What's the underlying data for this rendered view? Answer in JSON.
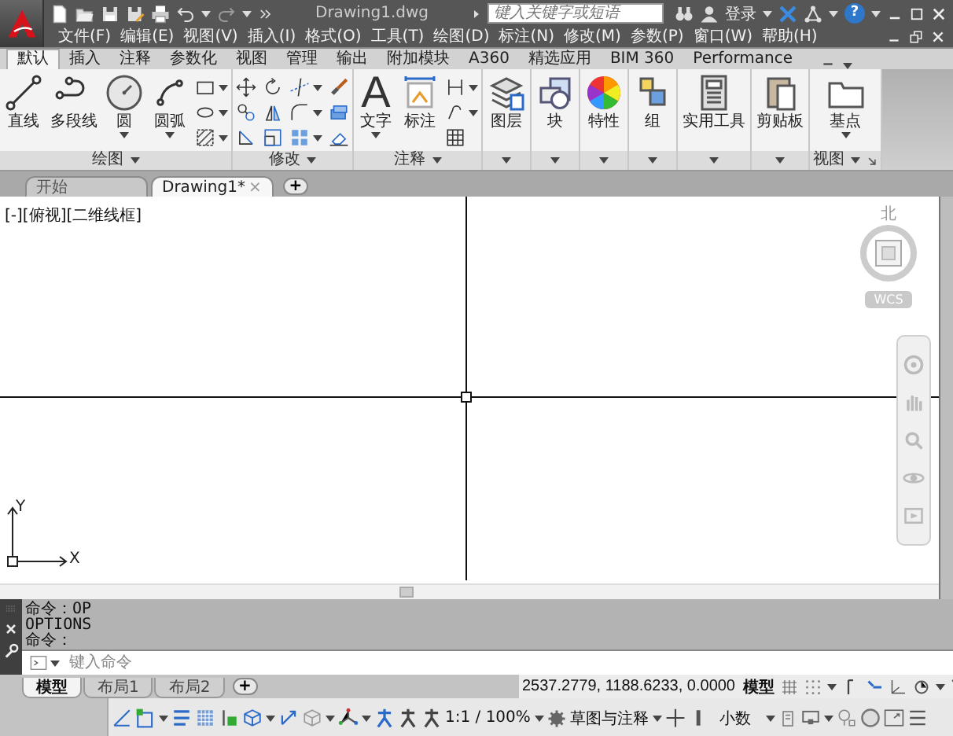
{
  "title_bar": {
    "title": "Drawing1.dwg",
    "search": {
      "placeholder": "键入关键字或短语"
    },
    "sign_in": "登录",
    "help": "?"
  },
  "menu_bar": {
    "items": [
      "文件(F)",
      "编辑(E)",
      "视图(V)",
      "插入(I)",
      "格式(O)",
      "工具(T)",
      "绘图(D)",
      "标注(N)",
      "修改(M)",
      "参数(P)",
      "窗口(W)",
      "帮助(H)"
    ]
  },
  "ribbon": {
    "tabs": [
      {
        "label": "默认",
        "selected": true
      },
      {
        "label": "插入",
        "selected": false
      },
      {
        "label": "注释",
        "selected": false
      },
      {
        "label": "参数化",
        "selected": false
      },
      {
        "label": "视图",
        "selected": false
      },
      {
        "label": "管理",
        "selected": false
      },
      {
        "label": "输出",
        "selected": false
      },
      {
        "label": "附加模块",
        "selected": false
      },
      {
        "label": "A360",
        "selected": false
      },
      {
        "label": "精选应用",
        "selected": false
      },
      {
        "label": "BIM 360",
        "selected": false
      },
      {
        "label": "Performance",
        "selected": false
      }
    ],
    "panels": [
      {
        "title": "绘图",
        "tools": [
          {
            "kind": "large",
            "label": "直线",
            "dropdown": false
          },
          {
            "kind": "large",
            "label": "多段线",
            "dropdown": false
          },
          {
            "kind": "large",
            "label": "圆",
            "dropdown": true
          },
          {
            "kind": "large",
            "label": "圆弧",
            "dropdown": true
          },
          {
            "kind": "small",
            "dropdown": true
          },
          {
            "kind": "small",
            "dropdown": true
          },
          {
            "kind": "small",
            "dropdown": true
          }
        ]
      },
      {
        "title": "修改",
        "tools": [
          {
            "kind": "small",
            "dropdown": false
          },
          {
            "kind": "small",
            "dropdown": false
          },
          {
            "kind": "small",
            "dropdown": false
          },
          {
            "kind": "small",
            "dropdown": false
          },
          {
            "kind": "small",
            "dropdown": false
          },
          {
            "kind": "small",
            "dropdown": false
          },
          {
            "kind": "small",
            "dropdown": true
          },
          {
            "kind": "small",
            "dropdown": true
          },
          {
            "kind": "small",
            "dropdown": true
          },
          {
            "kind": "small",
            "dropdown": false
          },
          {
            "kind": "small",
            "dropdown": false
          },
          {
            "kind": "small",
            "dropdown": false
          }
        ]
      },
      {
        "title": "注释",
        "tools": [
          {
            "kind": "glyph",
            "glyph": "A",
            "label": "文字",
            "dropdown": true
          },
          {
            "kind": "large",
            "label": "标注",
            "dropdown": false
          },
          {
            "kind": "small",
            "dropdown": true
          },
          {
            "kind": "small",
            "dropdown": true
          },
          {
            "kind": "small",
            "dropdown": false
          }
        ]
      },
      {
        "tools": [
          {
            "kind": "large",
            "label": "图层",
            "dropdown": false
          }
        ]
      },
      {
        "tools": [
          {
            "kind": "large",
            "label": "块",
            "dropdown": false
          }
        ]
      },
      {
        "tools": [
          {
            "kind": "large",
            "label": "特性",
            "dropdown": false
          }
        ]
      },
      {
        "tools": [
          {
            "kind": "large",
            "label": "组",
            "dropdown": false
          }
        ]
      },
      {
        "tools": [
          {
            "kind": "large",
            "label": "实用工具",
            "dropdown": false
          }
        ]
      },
      {
        "tools": [
          {
            "kind": "large",
            "label": "剪贴板",
            "dropdown": false
          }
        ]
      },
      {
        "title": "视图",
        "launcher": true,
        "tools": [
          {
            "kind": "large",
            "label": "基点",
            "dropdown": true
          }
        ]
      }
    ]
  },
  "document_tabs": {
    "tabs": [
      {
        "label": "开始",
        "selected": false
      },
      {
        "label": "Drawing1*",
        "selected": true,
        "close": "×"
      }
    ],
    "add": "+"
  },
  "viewport": {
    "label": "[-][俯视][二维线框]",
    "viewcube": {
      "north": "北",
      "wcs": "WCS"
    },
    "ucs": {
      "x": "X",
      "y": "Y"
    }
  },
  "command_line": {
    "history": [
      "命令：OP",
      "OPTIONS",
      "命令："
    ],
    "placeholder": "键入命令"
  },
  "layout_tabs": {
    "tabs": [
      {
        "label": "模型",
        "selected": true
      },
      {
        "label": "布局1",
        "selected": false
      },
      {
        "label": "布局2",
        "selected": false
      }
    ],
    "add": "+"
  },
  "status_bar": {
    "coordinates": "2537.2779, 1188.6233, 0.0000",
    "space": "模型",
    "scale": "1:1 / 100%",
    "workspace": "草图与注释",
    "units": "小数"
  }
}
